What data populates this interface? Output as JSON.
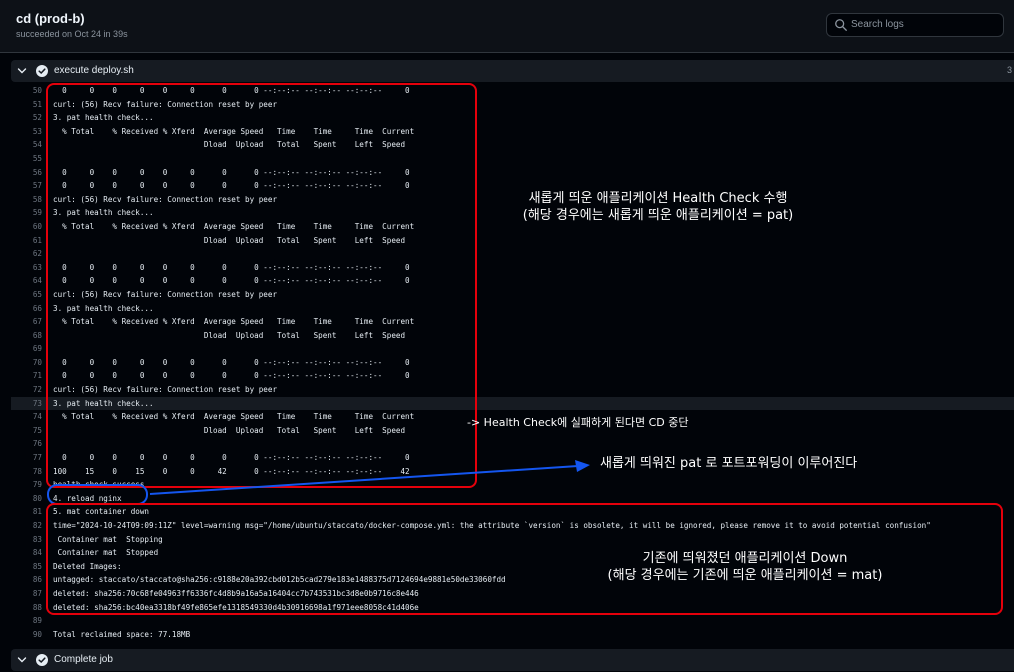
{
  "header": {
    "title": "cd (prod-b)",
    "subtitle": "succeeded on Oct 24 in 39s",
    "search_placeholder": "Search logs"
  },
  "steps": {
    "deploy": {
      "label": "execute deploy.sh",
      "duration": "3"
    },
    "complete": {
      "label": "Complete job"
    }
  },
  "log_lines": [
    {
      "n": "50",
      "t": "  0     0    0     0    0     0      0      0 --:--:-- --:--:-- --:--:--     0"
    },
    {
      "n": "51",
      "t": "curl: (56) Recv failure: Connection reset by peer"
    },
    {
      "n": "52",
      "t": "3. pat health check..."
    },
    {
      "n": "53",
      "t": "  % Total    % Received % Xferd  Average Speed   Time    Time     Time  Current"
    },
    {
      "n": "54",
      "t": "                                 Dload  Upload   Total   Spent    Left  Speed"
    },
    {
      "n": "55",
      "t": ""
    },
    {
      "n": "56",
      "t": "  0     0    0     0    0     0      0      0 --:--:-- --:--:-- --:--:--     0"
    },
    {
      "n": "57",
      "t": "  0     0    0     0    0     0      0      0 --:--:-- --:--:-- --:--:--     0"
    },
    {
      "n": "58",
      "t": "curl: (56) Recv failure: Connection reset by peer"
    },
    {
      "n": "59",
      "t": "3. pat health check..."
    },
    {
      "n": "60",
      "t": "  % Total    % Received % Xferd  Average Speed   Time    Time     Time  Current"
    },
    {
      "n": "61",
      "t": "                                 Dload  Upload   Total   Spent    Left  Speed"
    },
    {
      "n": "62",
      "t": ""
    },
    {
      "n": "63",
      "t": "  0     0    0     0    0     0      0      0 --:--:-- --:--:-- --:--:--     0"
    },
    {
      "n": "64",
      "t": "  0     0    0     0    0     0      0      0 --:--:-- --:--:-- --:--:--     0"
    },
    {
      "n": "65",
      "t": "curl: (56) Recv failure: Connection reset by peer"
    },
    {
      "n": "66",
      "t": "3. pat health check..."
    },
    {
      "n": "67",
      "t": "  % Total    % Received % Xferd  Average Speed   Time    Time     Time  Current"
    },
    {
      "n": "68",
      "t": "                                 Dload  Upload   Total   Spent    Left  Speed"
    },
    {
      "n": "69",
      "t": ""
    },
    {
      "n": "70",
      "t": "  0     0    0     0    0     0      0      0 --:--:-- --:--:-- --:--:--     0"
    },
    {
      "n": "71",
      "t": "  0     0    0     0    0     0      0      0 --:--:-- --:--:-- --:--:--     0"
    },
    {
      "n": "72",
      "t": "curl: (56) Recv failure: Connection reset by peer"
    },
    {
      "n": "73",
      "t": "3. pat health check..."
    },
    {
      "n": "74",
      "t": "  % Total    % Received % Xferd  Average Speed   Time    Time     Time  Current"
    },
    {
      "n": "75",
      "t": "                                 Dload  Upload   Total   Spent    Left  Speed"
    },
    {
      "n": "76",
      "t": ""
    },
    {
      "n": "77",
      "t": "  0     0    0     0    0     0      0      0 --:--:-- --:--:-- --:--:--     0"
    },
    {
      "n": "78",
      "t": "100    15    0    15    0     0     42      0 --:--:-- --:--:-- --:--:--    42"
    },
    {
      "n": "79",
      "t": "health check success"
    },
    {
      "n": "80",
      "t": "4. reload nginx"
    },
    {
      "n": "81",
      "t": "5. mat container down"
    },
    {
      "n": "82",
      "t": "time=\"2024-10-24T09:09:11Z\" level=warning msg=\"/home/ubuntu/staccato/docker-compose.yml: the attribute `version` is obsolete, it will be ignored, please remove it to avoid potential confusion\""
    },
    {
      "n": "83",
      "t": " Container mat  Stopping"
    },
    {
      "n": "84",
      "t": " Container mat  Stopped"
    },
    {
      "n": "85",
      "t": "Deleted Images:"
    },
    {
      "n": "86",
      "t": "untagged: staccato/staccato@sha256:c9188e20a392cbd012b5cad279e183e1488375d7124694e9881e50de33060fdd"
    },
    {
      "n": "87",
      "t": "deleted: sha256:70c68fe04963ff6336fc4d8b9a16a5a16404cc7b743531bc3d8e0b9716c8e446"
    },
    {
      "n": "88",
      "t": "deleted: sha256:bc40ea3318bf49fe865efe1318549330d4b30916698a1f971eee8058c41d406e"
    },
    {
      "n": "89",
      "t": ""
    },
    {
      "n": "90",
      "t": "Total reclaimed space: 77.18MB"
    }
  ],
  "annotations": {
    "health_check_line1": "새롭게 띄운 애플리케이션 Health Check 수행",
    "health_check_line2": "(해당 경우에는 새롭게 띄운 애플리케이션 = pat)",
    "fail_note": "-> Health Check에 실패하게 된다면 CD 중단",
    "forward_note": "새롭게 띄워진 pat 로 포트포워딩이 이루어진다",
    "down_line1": "기존에 띄워졌던 애플리케이션 Down",
    "down_line2": "(해당 경우에는 기존에 띄운 애플리케이션 = mat)"
  },
  "colors": {
    "red_box": "#e5000b",
    "blue_box": "#1456f0",
    "success_check": "#e6edf3"
  },
  "icons": {
    "search": "search-icon",
    "chevron": "chevron-down-icon",
    "check": "check-circle-icon"
  }
}
